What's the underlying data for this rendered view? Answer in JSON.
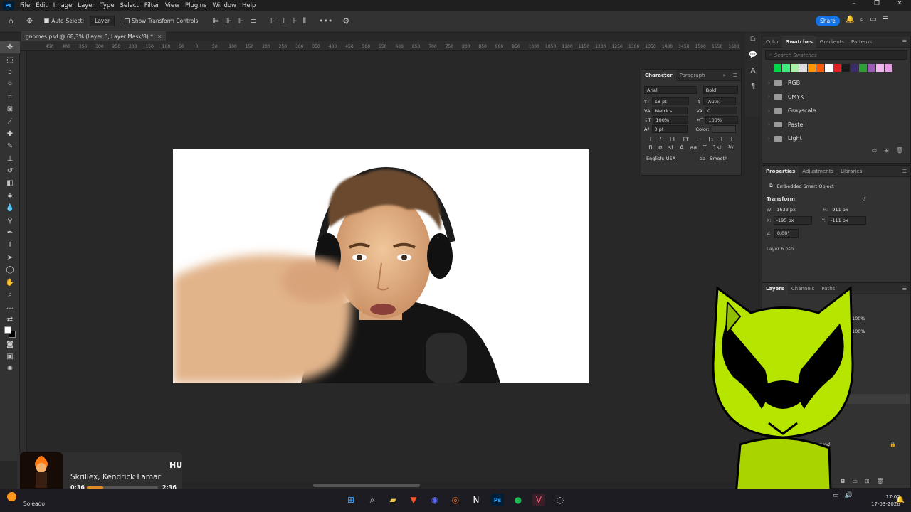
{
  "app": {
    "logo": "Ps"
  },
  "menu": [
    "File",
    "Edit",
    "Image",
    "Layer",
    "Type",
    "Select",
    "Filter",
    "View",
    "Plugins",
    "Window",
    "Help"
  ],
  "options": {
    "auto_select_label": "Auto-Select:",
    "auto_select_value": "Layer",
    "transform_label": "Show Transform Controls",
    "share_label": "Share"
  },
  "document": {
    "tab_title": "gnomes.psd @ 68,3% (Layer 6, Layer Mask/8) *"
  },
  "ruler_labels": [
    "450",
    "400",
    "350",
    "300",
    "250",
    "200",
    "150",
    "100",
    "50",
    "0",
    "50",
    "100",
    "150",
    "200",
    "250",
    "300",
    "350",
    "400",
    "450",
    "500",
    "550",
    "600",
    "650",
    "700",
    "750",
    "800",
    "850",
    "900",
    "950",
    "1000",
    "1050",
    "1100",
    "1150",
    "1200",
    "1250",
    "1300",
    "1350",
    "1400",
    "1450",
    "1500",
    "1550",
    "1600"
  ],
  "character": {
    "tabs": [
      "Character",
      "Paragraph"
    ],
    "font_family": "Arial",
    "font_style": "Bold",
    "size": "18 pt",
    "leading": "(Auto)",
    "kerning": "Metrics",
    "tracking": "0",
    "vscale": "100%",
    "hscale": "100%",
    "baseline": "0 pt",
    "color_label": "Color:",
    "language": "English: USA",
    "antialias": "Smooth"
  },
  "swatches": {
    "tabs": [
      "Color",
      "Swatches",
      "Gradients",
      "Patterns"
    ],
    "search_placeholder": "Search Swatches",
    "colors": [
      "#00d84a",
      "#3bf07a",
      "#a6f5a6",
      "#e0e0e0",
      "#ff9800",
      "#ff5a00",
      "#ffffff",
      "#e02020",
      "#1a1a1a",
      "#3d2c6b",
      "#2e9e3a",
      "#9b59b6",
      "#f3b6f0",
      "#e79be5"
    ],
    "groups": [
      "RGB",
      "CMYK",
      "Grayscale",
      "Pastel",
      "Light"
    ]
  },
  "properties": {
    "tabs": [
      "Properties",
      "Adjustments",
      "Libraries"
    ],
    "type": "Embedded Smart Object",
    "transform_label": "Transform",
    "w_label": "W:",
    "w": "1633 px",
    "h_label": "H:",
    "h": "911 px",
    "x_label": "X:",
    "x": "-195 px",
    "y_label": "Y:",
    "y": "-111 px",
    "angle": "0,00°",
    "file": "Layer 6.psb"
  },
  "layers": {
    "tabs": [
      "Layers",
      "Channels",
      "Paths"
    ],
    "opacity": "100%",
    "fill": "100%",
    "background_label": "Background"
  },
  "media": {
    "artist": "Skrillex, Kendrick Lamar",
    "title_fragment": "HU",
    "elapsed": "0:36",
    "duration": "2:36",
    "progress": 0.23
  },
  "taskbar": {
    "weather": "Soleado",
    "time": "17:02",
    "date": "17-03-2026"
  }
}
